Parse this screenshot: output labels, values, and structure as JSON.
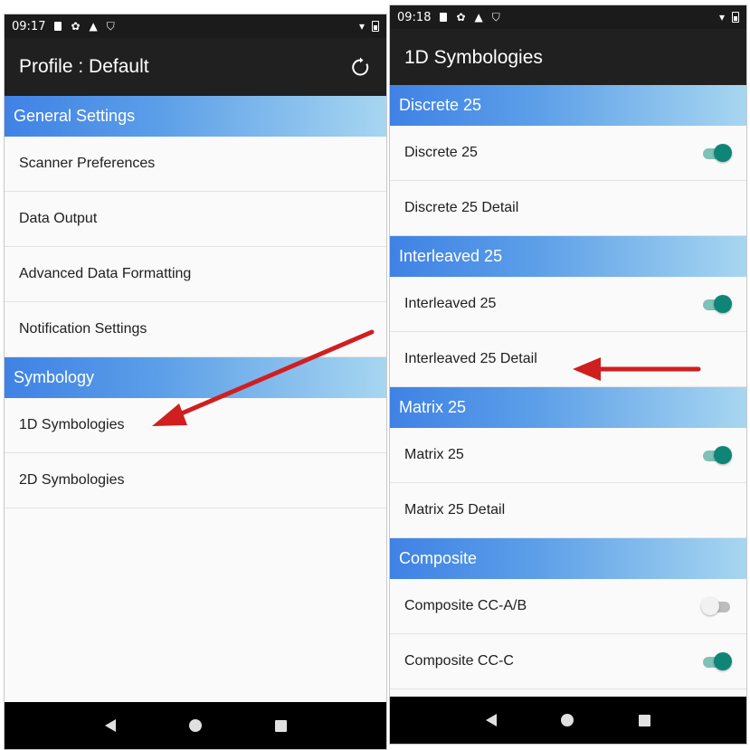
{
  "accent_colors": {
    "section_header_start": "#3f82e5",
    "section_header_end": "#a7d6f0",
    "toggle_on": "#0f8578",
    "arrow": "#cf1f1f"
  },
  "left_screen": {
    "status_bar": {
      "time": "09:17",
      "icons": [
        "sim-icon",
        "settings-icon",
        "warning-icon",
        "shield-icon"
      ],
      "right_icons": [
        "wifi-icon",
        "battery-icon"
      ]
    },
    "app_bar": {
      "title": "Profile : Default",
      "action_icon": "refresh-icon"
    },
    "sections": [
      {
        "header": "General Settings",
        "items": [
          "Scanner Preferences",
          "Data Output",
          "Advanced Data Formatting",
          "Notification Settings"
        ]
      },
      {
        "header": "Symbology",
        "items": [
          "1D Symbologies",
          "2D Symbologies"
        ]
      }
    ],
    "nav_bar": {
      "icons": [
        "back-icon",
        "home-icon",
        "recents-icon"
      ]
    }
  },
  "right_screen": {
    "status_bar": {
      "time": "09:18",
      "icons": [
        "sim-icon",
        "settings-icon",
        "warning-icon",
        "shield-icon"
      ],
      "right_icons": [
        "wifi-icon",
        "battery-icon"
      ]
    },
    "app_bar": {
      "title": "1D Symbologies"
    },
    "sections": [
      {
        "header": "Discrete 25",
        "items": [
          {
            "label": "Discrete 25",
            "toggle": true
          },
          {
            "label": "Discrete 25 Detail"
          }
        ]
      },
      {
        "header": "Interleaved 25",
        "items": [
          {
            "label": "Interleaved 25",
            "toggle": true
          },
          {
            "label": "Interleaved 25 Detail"
          }
        ]
      },
      {
        "header": "Matrix 25",
        "items": [
          {
            "label": "Matrix 25",
            "toggle": true
          },
          {
            "label": "Matrix 25 Detail"
          }
        ]
      },
      {
        "header": "Composite",
        "items": [
          {
            "label": "Composite CC-A/B",
            "toggle": false
          },
          {
            "label": "Composite CC-C",
            "toggle": true
          }
        ]
      }
    ],
    "nav_bar": {
      "icons": [
        "back-icon",
        "home-icon",
        "recents-icon"
      ]
    }
  },
  "annotations": [
    {
      "type": "arrow",
      "points_to": "1D Symbologies"
    },
    {
      "type": "arrow",
      "points_to": "Interleaved 25 Detail"
    }
  ]
}
